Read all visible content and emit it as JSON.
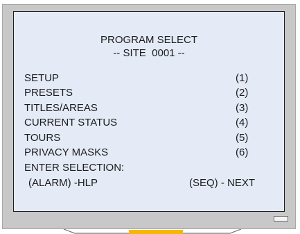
{
  "screen": {
    "title": "PROGRAM SELECT",
    "subtitle": "-- SITE  0001 --",
    "menu": [
      {
        "label": "SETUP",
        "num": "(1)"
      },
      {
        "label": "PRESETS",
        "num": "(2)"
      },
      {
        "label": "TITLES/AREAS",
        "num": "(3)"
      },
      {
        "label": "CURRENT STATUS",
        "num": "(4)"
      },
      {
        "label": "TOURS",
        "num": "(5)"
      },
      {
        "label": "PRIVACY MASKS",
        "num": "(6)"
      }
    ],
    "prompt": "ENTER SELECTION:",
    "help_hint": "(ALARM) -HLP",
    "next_hint": "(SEQ) - NEXT"
  },
  "colors": {
    "bezel": "#c8c8c8",
    "screen_background": "#e4eaf6",
    "text": "#1c1c1c",
    "stand_accent": "#f5b800"
  },
  "icons": {
    "status_led": "power-indicator-icon"
  }
}
